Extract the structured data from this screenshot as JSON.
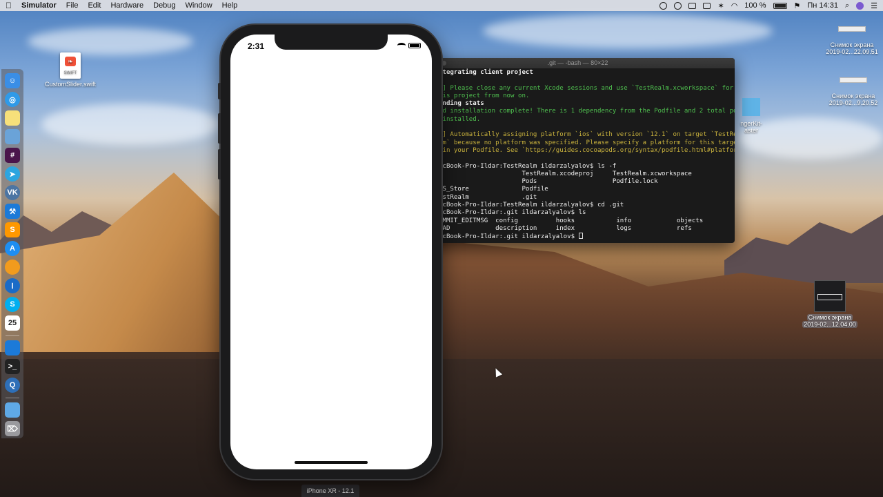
{
  "menubar": {
    "app_name": "Simulator",
    "menus": [
      "File",
      "Edit",
      "Hardware",
      "Debug",
      "Window",
      "Help"
    ],
    "battery": "100 %",
    "clock": "Пн 14:31"
  },
  "desktop": {
    "swift_file": {
      "name": "CustomSlider.swift",
      "icon_text": "SWIFT"
    },
    "screenshots": [
      {
        "line1": "Снимок экрана",
        "line2": "2019-02...22.09.51"
      },
      {
        "line1": "Снимок экрана",
        "line2": "2019-02...9.20.52"
      },
      {
        "line1": "Снимок экрана",
        "line2": "2019-02...12.04.00"
      }
    ],
    "partial_item": {
      "line1": "ngerKit-",
      "line2": "aster"
    }
  },
  "terminal": {
    "title": ".git — -bash — 80×22",
    "lines": [
      {
        "text": "ntegrating client project",
        "color": "bold"
      },
      {
        "text": "",
        "color": "plain"
      },
      {
        "text": "!] Please close any current Xcode sessions and use `TestRealm.xcworkspace` for",
        "color": "green"
      },
      {
        "text": "his project from now on.",
        "color": "green"
      },
      {
        "text": "ending stats",
        "color": "bold"
      },
      {
        "text": "od installation complete! There is 1 dependency from the Podfile and 2 total po",
        "color": "green"
      },
      {
        "text": " installed.",
        "color": "green"
      },
      {
        "text": "",
        "color": "plain"
      },
      {
        "text": "!] Automatically assigning platform `ios` with version `12.1` on target `TestRe",
        "color": "yellow"
      },
      {
        "text": "lm` because no platform was specified. Please specify a platform for this targe",
        "color": "yellow"
      },
      {
        "text": " in your Podfile. See `https://guides.cocoapods.org/syntax/podfile.html#platfor",
        "color": "yellow"
      },
      {
        "text": ".",
        "color": "yellow"
      },
      {
        "text": "acBook-Pro-Ildar:TestRealm ildarzalyalov$ ls -f",
        "color": "plain"
      },
      {
        "text": "                      TestRealm.xcodeproj     TestRealm.xcworkspace",
        "color": "plain"
      },
      {
        "text": ".                     Pods                    Podfile.lock",
        "color": "plain"
      },
      {
        "text": "DS_Store              Podfile",
        "color": "plain"
      },
      {
        "text": "estRealm              .git",
        "color": "plain"
      },
      {
        "text": "acBook-Pro-Ildar:TestRealm ildarzalyalov$ cd .git",
        "color": "plain"
      },
      {
        "text": "acBook-Pro-Ildar:.git ildarzalyalov$ ls",
        "color": "plain"
      },
      {
        "text": "OMMIT_EDITMSG  config          hooks           info            objects",
        "color": "plain"
      },
      {
        "text": "EAD            description     index           logs            refs",
        "color": "plain"
      }
    ],
    "prompt": "acBook-Pro-Ildar:.git ildarzalyalov$ "
  },
  "simulator": {
    "time": "2:31",
    "device_label": "iPhone XR - 12.1"
  }
}
